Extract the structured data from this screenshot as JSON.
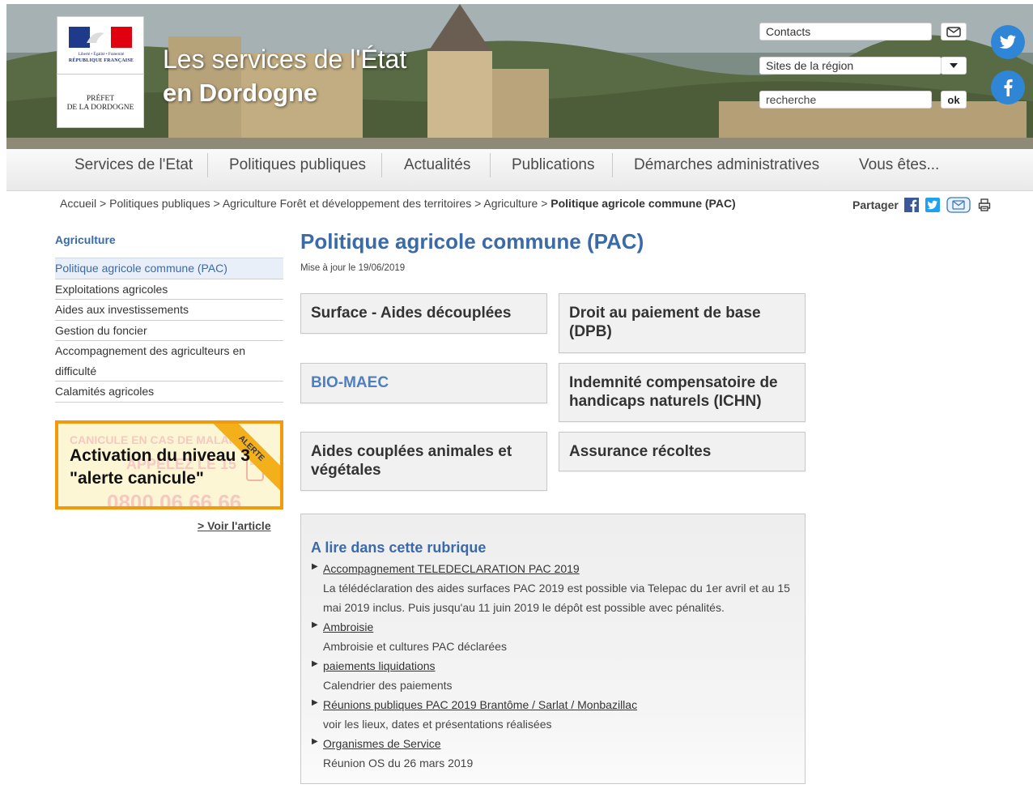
{
  "header": {
    "logo": {
      "motto": "Liberté • Égalité • Fraternité",
      "republic": "RÉPUBLIQUE FRANÇAISE",
      "prefet_line1": "PRÉFET",
      "prefet_line2": "DE LA DORDOGNE"
    },
    "title_line1": "Les services de l'État",
    "title_line2": "en Dordogne",
    "contacts_label": "Contacts",
    "region_select_value": "Sites de la région",
    "search_placeholder": "recherche",
    "search_button": "ok"
  },
  "nav": {
    "items": [
      {
        "label": "Services de l'Etat"
      },
      {
        "label": "Politiques publiques"
      },
      {
        "label": "Actualités"
      },
      {
        "label": "Publications"
      },
      {
        "label": "Démarches administratives"
      },
      {
        "label": "Vous êtes..."
      }
    ]
  },
  "breadcrumb": {
    "items": [
      "Accueil",
      "Politiques publiques",
      "Agriculture Forêt et développement des territoires",
      "Agriculture"
    ],
    "separator": " > ",
    "current": "Politique agricole commune (PAC)"
  },
  "share": {
    "label": "Partager"
  },
  "sidebar": {
    "title": "Agriculture",
    "items": [
      {
        "label": "Politique agricole commune (PAC)",
        "active": true
      },
      {
        "label": "Exploitations agricoles"
      },
      {
        "label": "Aides aux investissements"
      },
      {
        "label": "Gestion du foncier"
      },
      {
        "label": "Accompagnement des agriculteurs en difficulté"
      },
      {
        "label": "Calamités agricoles"
      }
    ],
    "alert": {
      "ribbon": "ALERTE",
      "text": "Activation du niveau 3 \"alerte canicule\"",
      "bg_text_1": "CANICULE  EN CAS DE MALAISE",
      "bg_text_2": "APPELEZ LE 15",
      "bg_text_3": "0800 06 66 66"
    },
    "voir_link": "> Voir l'article"
  },
  "main": {
    "title": "Politique agricole commune (PAC)",
    "update": "Mise à jour le 19/06/2019",
    "tiles": [
      {
        "label": "Surface - Aides découplées"
      },
      {
        "label": "Droit au paiement de base (DPB)"
      },
      {
        "label": "BIO-MAEC"
      },
      {
        "label": "Indemnité compensatoire de handicaps naturels (ICHN)"
      },
      {
        "label": "Aides couplées animales et végétales"
      },
      {
        "label": "Assurance récoltes"
      }
    ],
    "rubrique": {
      "title": "A lire dans cette rubrique",
      "items": [
        {
          "link": "Accompagnement TELEDECLARATION PAC 2019",
          "desc": "La télédéclaration des aides surfaces PAC 2019 est possible via Telepac du 1er avril et au 15 mai 2019 inclus. Puis jusqu'au 11 juin 2019 le dépôt est possible avec pénalités."
        },
        {
          "link": "Ambroisie",
          "desc": "Ambroisie et cultures PAC déclarées"
        },
        {
          "link": "paiements liquidations",
          "desc": "Calendrier des paiements"
        },
        {
          "link": "Réunions publiques PAC 2019 Brantôme / Sarlat / Monbazillac",
          "desc": "voir les lieux, dates et présentations réalisées"
        },
        {
          "link": "Organismes de Service",
          "desc": "Réunion OS du 26 mars 2019"
        }
      ]
    }
  },
  "colors": {
    "accent_blue": "#3a6aa8",
    "tile_link_blue": "#4f7fbf",
    "alert_orange": "#f29a0a",
    "social_blue": "#2f86d7"
  },
  "icons": [
    "mail-icon",
    "chevron-down-icon",
    "twitter-icon",
    "facebook-icon",
    "print-icon",
    "arrow-right-icon"
  ]
}
